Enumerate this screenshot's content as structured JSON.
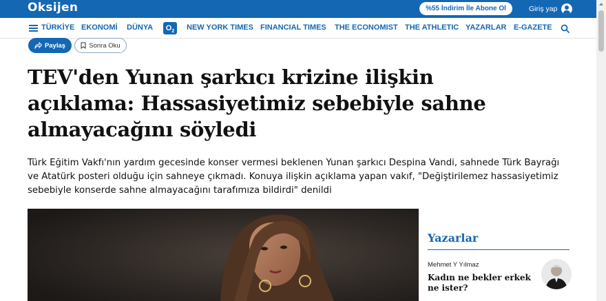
{
  "header": {
    "logo": "Oksijen",
    "promo_label": "%55 İndirim İle Abone Ol",
    "login_label": "Giriş yap",
    "user_icon": "user-circle-icon"
  },
  "nav": {
    "menu_icon": "hamburger-icon",
    "items": [
      "TÜRKİYE",
      "EKONOMİ",
      "DÜNYA",
      "NEW YORK TIMES",
      "FINANCIAL TIMES",
      "THE ECONOMIST",
      "THE ATHLETIC",
      "YAZARLAR",
      "E-GAZETE"
    ],
    "o2_badge": "O",
    "o2_sub": "2",
    "search_icon": "search-icon"
  },
  "actions": {
    "share_label": "Paylaş",
    "share_icon": "share-arrow-icon",
    "save_label": "Sonra Oku",
    "save_icon": "bookmark-icon"
  },
  "article": {
    "headline": "TEV'den Yunan şarkıcı krizine ilişkin açıklama: Hassasiyetimiz sebebiyle sahne almayacağını söyledi",
    "spot": "Türk Eğitim Vakfı'nın yardım gecesinde konser vermesi beklenen Yunan şarkıcı Despina Vandi, sahnede Türk Bayrağı ve Atatürk posteri olduğu için sahneye çıkmadı. Konuya ilişkin açıklama yapan vakıf, \"Değiştirilemez hassasiyetimiz sebebiyle konserde sahne almayacağını tarafımıza bildirdi\" denildi"
  },
  "sidebar": {
    "title": "Yazarlar",
    "author_name": "Mehmet Y Yılmaz",
    "author_article": "Kadın ne bekler erkek ne ister?"
  },
  "colors": {
    "brand_blue": "#1467b3"
  }
}
